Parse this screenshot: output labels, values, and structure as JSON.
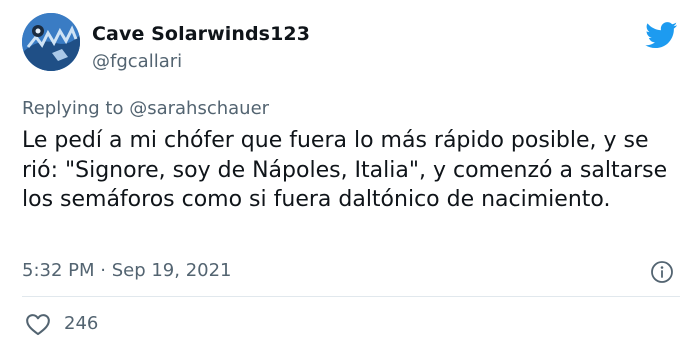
{
  "user": {
    "display_name": "Cave Solarwinds123",
    "handle": "@fgcallari"
  },
  "reply": {
    "prefix": "Replying to ",
    "mention": "@sarahschauer"
  },
  "tweet_text": "Le pedí a mi chófer que fuera lo más rápido posible, y se rió: \"Signore, soy de Nápoles, Italia\", y comenzó a saltarse los semáforos como si fuera daltónico de nacimiento.",
  "meta": {
    "time": "5:32 PM",
    "separator": " · ",
    "date": "Sep 19, 2021"
  },
  "likes": {
    "count": "246"
  },
  "icons": {
    "brand": "twitter-bird-icon",
    "info": "info-icon",
    "like": "heart-icon"
  },
  "colors": {
    "brand_blue": "#1d9bf0",
    "text_primary": "#0f1419",
    "text_secondary": "#536471"
  }
}
